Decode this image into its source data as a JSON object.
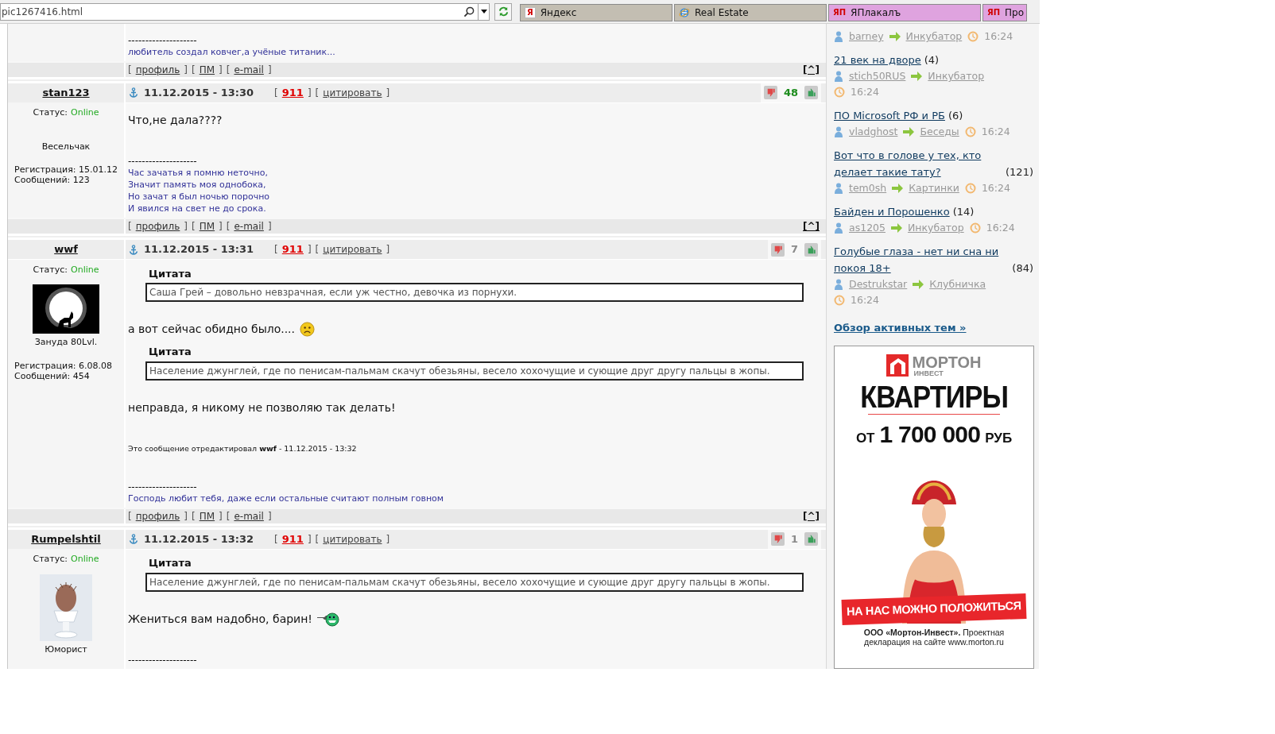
{
  "browser": {
    "address": "pic1267416.html",
    "tabs": [
      {
        "kind": "badge",
        "badge": "Я",
        "label": "Яндекс",
        "color": "#c3beb2"
      },
      {
        "kind": "globe",
        "label": "Real Estate",
        "color": "#c3beb2"
      },
      {
        "kind": "badge",
        "badge": "ЯП",
        "label": "ЯПлакалъ",
        "color": "#dfa3df"
      },
      {
        "kind": "badge",
        "badge": "ЯП",
        "label": "Про",
        "color": "#dfa3df"
      }
    ]
  },
  "posts": [
    {
      "body": [
        {
          "kind": "separator",
          "text": "--------------------"
        },
        {
          "kind": "signature",
          "lines": [
            "любитель создал ковчег,а учёные титаник..."
          ]
        }
      ],
      "footer": {
        "open": "[",
        "close": "]",
        "links": [
          "профиль",
          "ПМ",
          "e-mail"
        ],
        "top_link": "[^]"
      }
    },
    {
      "author": {
        "name": "stan123",
        "status_label": "Статус:",
        "status": "Online",
        "rank": "Весельчак",
        "registration": "Регистрация: 15.01.12",
        "messages": "Сообщений: 123"
      },
      "header": {
        "date": "11.12.2015 - 13:30",
        "open": "[",
        "close": "]",
        "actions": [
          {
            "kind": "alert",
            "text": "911"
          },
          {
            "kind": "plain",
            "text": "цитировать"
          }
        ],
        "rating": "48",
        "rating_positive": true
      },
      "body": [
        {
          "kind": "text",
          "text": "Что,не дала????"
        },
        {
          "kind": "separator",
          "text": "--------------------"
        },
        {
          "kind": "signature",
          "lines": [
            "Час зачатья я помню неточно,",
            "Значит память моя однобока,",
            "Но зачат я был ночью порочно",
            "И явился на свет не до срока."
          ]
        }
      ],
      "footer": {
        "open": "[",
        "close": "]",
        "links": [
          "профиль",
          "ПМ",
          "e-mail"
        ],
        "top_link": "[^]"
      }
    },
    {
      "author": {
        "name": "wwf",
        "status_label": "Статус:",
        "status": "Online",
        "rank": "Зануда 80Lvl.",
        "registration": "Регистрация: 6.08.08",
        "messages": "Сообщений: 454"
      },
      "header": {
        "date": "11.12.2015 - 13:31",
        "open": "[",
        "close": "]",
        "actions": [
          {
            "kind": "alert",
            "text": "911"
          },
          {
            "kind": "plain",
            "text": "цитировать"
          }
        ],
        "rating": "7",
        "rating_positive": false
      },
      "body": [
        {
          "kind": "quote",
          "title": "Цитата",
          "text": "Саша Грей – довольно невзрачная, если уж честно, девочка из порнухи."
        },
        {
          "kind": "text",
          "text": "а вот сейчас обидно было....",
          "emoticon": true
        },
        {
          "kind": "quote",
          "title": "Цитата",
          "text": "Население джунглей, где по пенисам-пальмам скачут обезьяны, весело хохочущие и сующие друг другу пальцы в жопы."
        },
        {
          "kind": "text",
          "text": "неправда, я никому не позволяю так делать!"
        },
        {
          "kind": "edit",
          "text": "Это сообщение отредактировал **wwf** - 11.12.2015 - 13:32"
        },
        {
          "kind": "separator",
          "text": "--------------------"
        },
        {
          "kind": "signature",
          "lines": [
            "Господь любит тебя, даже если остальные считают полным говном"
          ]
        }
      ],
      "footer": {
        "open": "[",
        "close": "]",
        "links": [
          "профиль",
          "ПМ",
          "e-mail"
        ],
        "top_link": "[^]"
      }
    },
    {
      "author": {
        "name": "Rumpelshtil",
        "status_label": "Статус:",
        "status": "Online",
        "rank": "Юморист"
      },
      "header": {
        "date": "11.12.2015 - 13:32",
        "open": "[",
        "close": "]",
        "actions": [
          {
            "kind": "alert",
            "text": "911"
          },
          {
            "kind": "plain",
            "text": "цитировать"
          }
        ],
        "rating": "1",
        "rating_positive": false
      },
      "body": [
        {
          "kind": "quote",
          "title": "Цитата",
          "text": "Население джунглей, где по пенисам-пальмам скачут обезьяны, весело хохочущие и сующие друг другу пальцы в жопы."
        },
        {
          "kind": "text",
          "text": "Жениться вам надобно, барин!",
          "emoticon": true
        },
        {
          "kind": "separator",
          "text": "--------------------"
        }
      ]
    }
  ],
  "sidebar": {
    "topics": [
      {
        "user": "barney",
        "forum": "Инкубатор",
        "time": "16:24"
      },
      {
        "title": "21 век на дворе",
        "count": "(4)",
        "user": "stich50RUS",
        "forum": "Инкубатор",
        "time": "16:24"
      },
      {
        "title": "ПО Microsoft РФ и РБ",
        "count": "(6)",
        "user": "vladghost",
        "forum": "Беседы",
        "time": "16:24"
      },
      {
        "title": "Вот что в голове у тех, кто делает такие тату?",
        "count": "(121)",
        "user": "tem0sh",
        "forum": "Картинки",
        "time": "16:24"
      },
      {
        "title": "Байден и Порошенко",
        "count": "(14)",
        "user": "as1205",
        "forum": "Инкубатор",
        "time": "16:24"
      },
      {
        "title": "Голубые глаза - нет ни сна ни покоя 18+",
        "count": "(84)",
        "user": "Destrukstar",
        "forum": "Клубничка",
        "time": "16:24"
      }
    ],
    "more_link": "Обзор активных тем »",
    "ad": {
      "logo": "МОРТОН",
      "logo_sub": "ИНВЕСТ",
      "headline": "КВАРТИРЫ",
      "price_prefix": "ОТ",
      "price": "1 700 000",
      "price_suffix": "РУБ",
      "slogan": "НА НАС МОЖНО ПОЛОЖИТЬСЯ",
      "disclaimer": "**ООО «Мортон-Инвест».** Проектная декларация на сайте www.morton.ru"
    }
  }
}
